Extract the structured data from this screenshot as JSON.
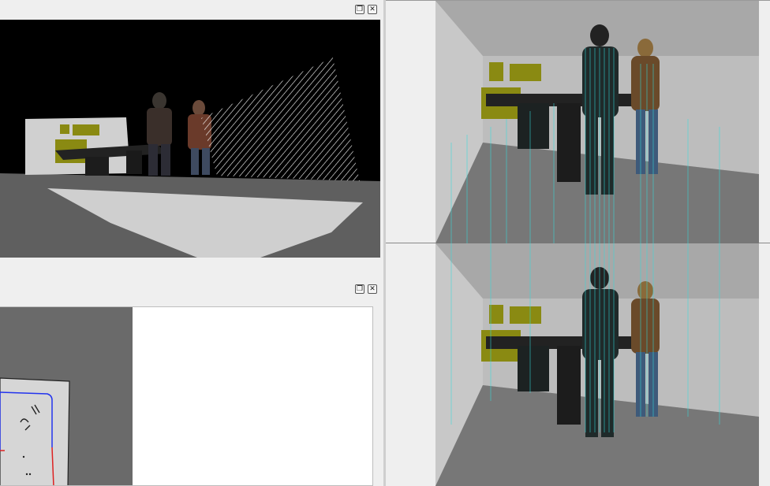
{
  "panels": {
    "camera_view": {
      "title_buttons": [
        {
          "name": "float-button",
          "glyph": "❐"
        },
        {
          "name": "close-button",
          "glyph": "✕"
        }
      ]
    },
    "map_view": {
      "title_buttons": [
        {
          "name": "float-button",
          "glyph": "❐"
        },
        {
          "name": "close-button",
          "glyph": "✕"
        }
      ]
    }
  },
  "colors": {
    "panel_bg": "#efefef",
    "scene_wall": "#000000",
    "scene_floor": "#5f5f5f",
    "laser_scan": "#ffffff",
    "pointcloud": "#33dddd",
    "map_unknown": "#6a6a6a",
    "map_free": "#d6d6d6",
    "map_path_blue": "#2233ee",
    "map_path_red": "#dd2222",
    "table_yellow": "#8a8a12"
  }
}
